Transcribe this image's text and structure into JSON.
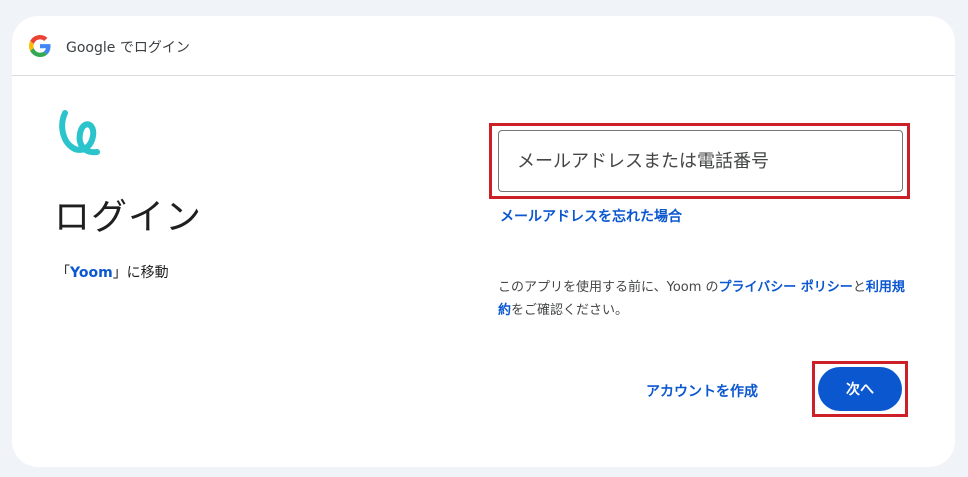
{
  "header": {
    "title": "Google でログイン",
    "logo_icon": "google-g-logo"
  },
  "brand": {
    "logo_icon": "yoom-logo",
    "color": "#2cc4cc"
  },
  "main": {
    "title": "ログイン",
    "continue_prefix": "「",
    "continue_app": "Yoom",
    "continue_suffix": "」に移動"
  },
  "form": {
    "email_placeholder": "メールアドレスまたは電話番号",
    "email_value": "",
    "forgot_email_link": "メールアドレスを忘れた場合"
  },
  "terms": {
    "prefix": "このアプリを使用する前に、Yoom の",
    "privacy_link": "プライバシー ポリシー",
    "middle": "と",
    "terms_link": "利用規約",
    "suffix": "をご確認ください。"
  },
  "actions": {
    "create_account": "アカウントを作成",
    "next": "次へ"
  },
  "colors": {
    "accent": "#0b57d0",
    "highlight_box": "#cc1f28",
    "background": "#f0f3f8"
  }
}
